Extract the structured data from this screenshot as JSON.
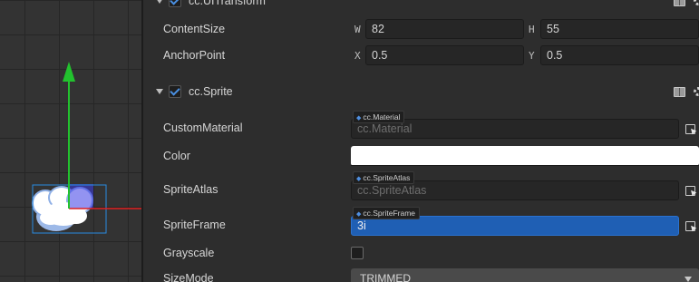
{
  "transform": {
    "title": "cc.UITransform",
    "content_size": {
      "label": "ContentSize",
      "w_axis": "W",
      "w": "82",
      "h_axis": "H",
      "h": "55"
    },
    "anchor_point": {
      "label": "AnchorPoint",
      "x_axis": "X",
      "x": "0.5",
      "y_axis": "Y",
      "y": "0.5"
    }
  },
  "sprite": {
    "title": "cc.Sprite",
    "custom_material": {
      "label": "CustomMaterial",
      "tag": "cc.Material",
      "placeholder": "cc.Material"
    },
    "color": {
      "label": "Color",
      "value": "#ffffff"
    },
    "sprite_atlas": {
      "label": "SpriteAtlas",
      "tag": "cc.SpriteAtlas",
      "placeholder": "cc.SpriteAtlas"
    },
    "sprite_frame": {
      "label": "SpriteFrame",
      "tag": "cc.SpriteFrame",
      "value": "3i"
    },
    "grayscale": {
      "label": "Grayscale",
      "checked": false
    },
    "size_mode": {
      "label": "SizeMode",
      "value": "TRIMMED"
    }
  },
  "colors": {
    "accent": "#1f5fb4",
    "axis_y": "#22c32e",
    "axis_x": "#e02020"
  }
}
